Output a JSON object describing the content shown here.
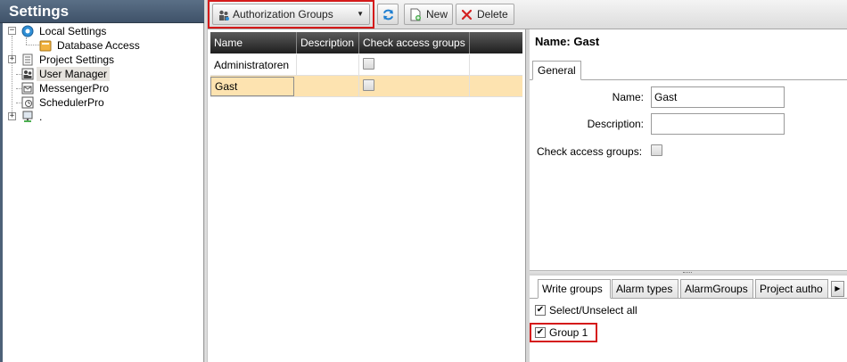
{
  "sidebar": {
    "title": "Settings",
    "tree": [
      {
        "label": "Local Settings",
        "icon": "gear-icon"
      },
      {
        "label": "Database Access",
        "icon": "database-icon"
      },
      {
        "label": "Project Settings",
        "icon": "document-icon"
      },
      {
        "label": "User Manager",
        "icon": "users-icon",
        "selected": true
      },
      {
        "label": "MessengerPro",
        "icon": "messenger-icon"
      },
      {
        "label": "SchedulerPro",
        "icon": "scheduler-icon"
      },
      {
        "label": ".",
        "icon": "computer-icon"
      }
    ]
  },
  "toolbar": {
    "dropdown_label": "Authorization Groups",
    "new_label": "New",
    "delete_label": "Delete"
  },
  "grid": {
    "columns": [
      "Name",
      "Description",
      "Check access groups"
    ],
    "rows": [
      {
        "name": "Administratoren",
        "description": "",
        "check_access": false
      },
      {
        "name": "Gast",
        "description": "",
        "check_access": false,
        "selected": true
      }
    ]
  },
  "detail": {
    "title": "Name:  Gast",
    "tab_general": "General",
    "name_label": "Name:",
    "name_value": "Gast",
    "description_label": "Description:",
    "description_value": "",
    "check_label": "Check access groups:"
  },
  "bottom": {
    "tabs": [
      "Write groups",
      "Alarm types",
      "AlarmGroups",
      "Project autho"
    ],
    "select_all_label": "Select/Unselect all",
    "groups": [
      {
        "label": "Group 1",
        "checked": true
      }
    ]
  },
  "colors": {
    "header_blue": "#4f6379",
    "selected_row": "#fde3b0",
    "highlight_red": "#d51a1a"
  }
}
